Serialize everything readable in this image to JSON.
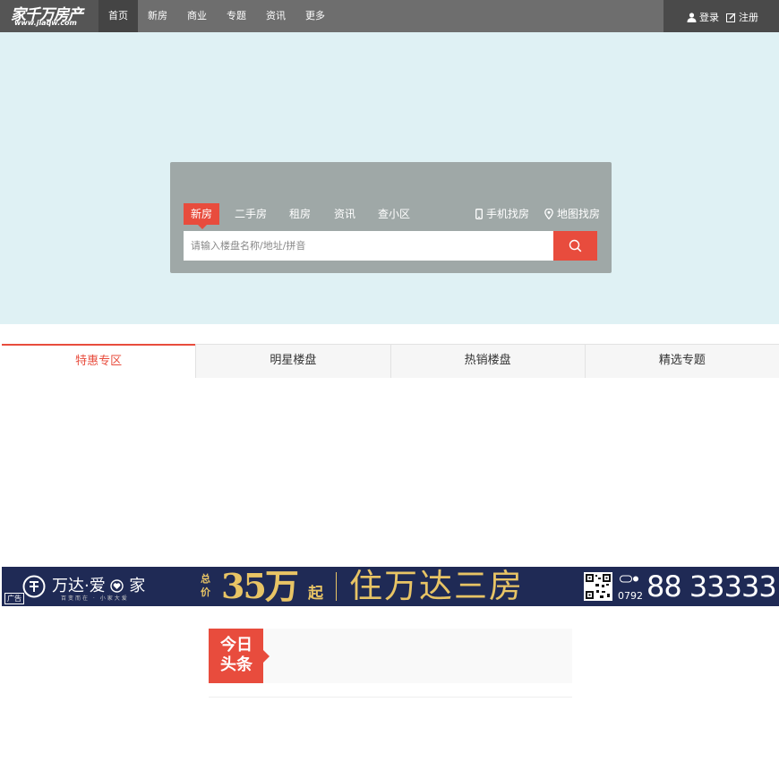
{
  "colors": {
    "accent": "#e84c3d",
    "topbar": "#6e6e6e",
    "hero_bg": "#dff1f4",
    "banner_bg": "#1f2a55",
    "banner_gold": "#e8c465"
  },
  "header": {
    "logo_text": "家千万房产",
    "logo_url_text": "www.jiaqw.com",
    "nav": [
      "首页",
      "新房",
      "商业",
      "专题",
      "资讯",
      "更多"
    ],
    "login_label": "登录",
    "register_label": "注册",
    "login_icon": "user-icon",
    "register_icon": "edit-icon"
  },
  "search": {
    "tabs": [
      "新房",
      "二手房",
      "租房",
      "资讯",
      "查小区"
    ],
    "active_tab": "新房",
    "mobile_label": "手机找房",
    "map_label": "地图找房",
    "placeholder": "请输入楼盘名称/地址/拼音",
    "button_icon": "search-icon"
  },
  "property_tabs": [
    "特惠专区",
    "明星楼盘",
    "热销楼盘",
    "精选专题"
  ],
  "banner": {
    "ad_label": "广告",
    "brand": "万达·爱",
    "brand_suffix": "家",
    "slogan": "百变而在 · 小家大爱",
    "total_price_label": "总价",
    "price": "35万",
    "price_suffix": "起",
    "headline": "住万达三房",
    "area_code": "0792",
    "phone": "88 33333"
  },
  "news": {
    "label_line1": "今日",
    "label_line2": "头条"
  }
}
